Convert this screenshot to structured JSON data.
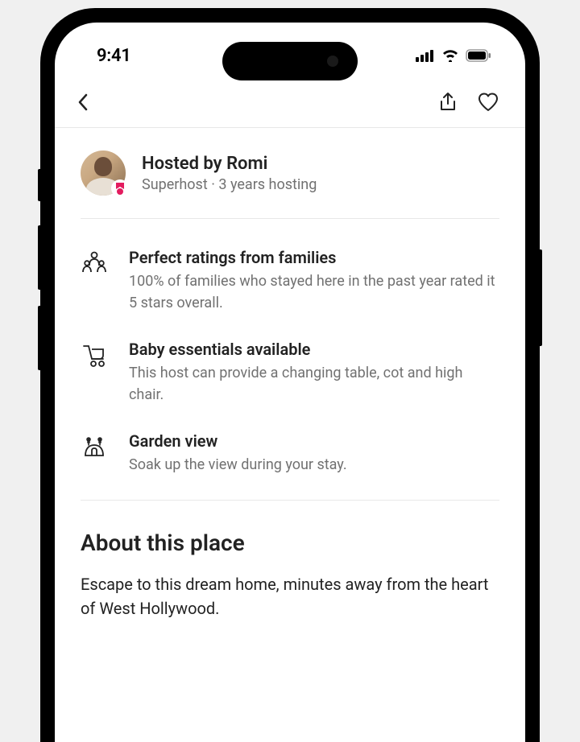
{
  "status": {
    "time": "9:41"
  },
  "host": {
    "title": "Hosted by Romi",
    "badge": "Superhost",
    "separator": " · ",
    "tenure": "3 years hosting"
  },
  "features": [
    {
      "title": "Perfect ratings from families",
      "description": "100% of families who stayed here in the past year rated it 5 stars overall."
    },
    {
      "title": "Baby essentials available",
      "description": "This host can provide a changing table, cot and high chair."
    },
    {
      "title": "Garden view",
      "description": "Soak up the view during your stay."
    }
  ],
  "about": {
    "heading": "About this place",
    "body": "Escape to this dream home, minutes away from the heart of West Hollywood."
  }
}
